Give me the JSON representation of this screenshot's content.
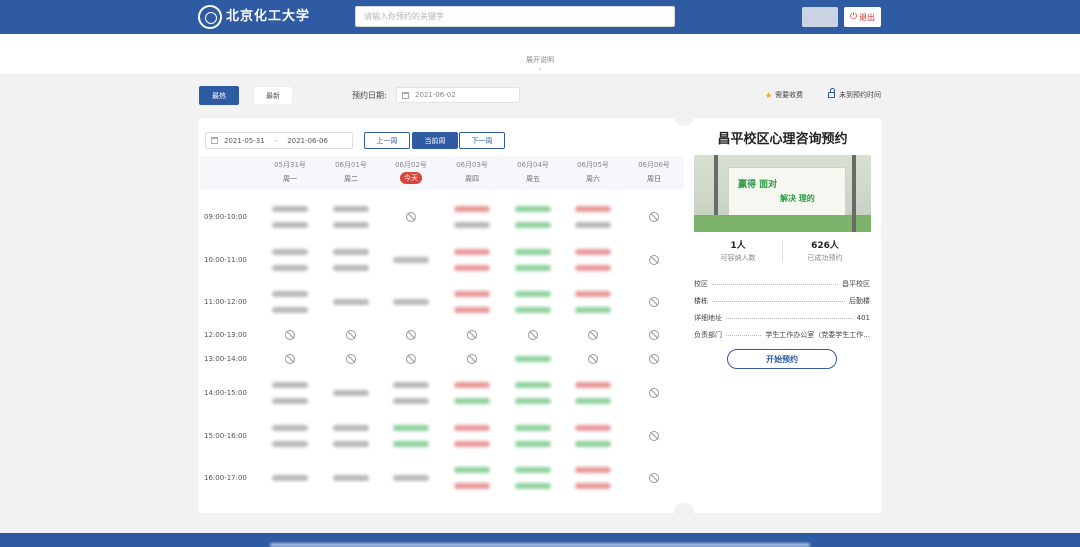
{
  "header": {
    "logo_text": "北京化工大学",
    "search_placeholder": "请输入你预约的关键字",
    "logout_label": "退出",
    "logout_icon": "power-icon"
  },
  "explain": {
    "label": "展开说明",
    "icon": "chevron-down-icon"
  },
  "filters": {
    "hot_label": "最热",
    "new_label": "最新",
    "date_label": "预约日期:",
    "date_value": "2021-06-02",
    "legend_favorite": "需要收费",
    "legend_locked": "未到预约时间"
  },
  "week": {
    "range_start": "2021-05-31",
    "range_sep": "-",
    "range_end": "2021-06-06",
    "prev_label": "上一周",
    "current_label": "当前周",
    "next_label": "下一周"
  },
  "days": [
    {
      "date": "05月31号",
      "weekday": "周一"
    },
    {
      "date": "06月01号",
      "weekday": "周二"
    },
    {
      "date": "06月02号",
      "weekday": "今天"
    },
    {
      "date": "06月03号",
      "weekday": "周四"
    },
    {
      "date": "06月04号",
      "weekday": "周五"
    },
    {
      "date": "06月05号",
      "weekday": "周六"
    },
    {
      "date": "06月06号",
      "weekday": "周日"
    }
  ],
  "slots": [
    "09:00-10:00",
    "10:00-11:00",
    "11:00-12:00",
    "12:00-13:00",
    "13:00-14:00",
    "14:00-15:00",
    "15:00-16:00",
    "16:00-17:00"
  ],
  "side": {
    "title": "昌平校区心理咨询预约",
    "image_text1": "赢得 面对",
    "image_text2": "解决 理的",
    "capacity_value": "1人",
    "capacity_label": "可容纳人数",
    "success_value": "626人",
    "success_label": "已成功预约",
    "info": [
      {
        "key": "校区",
        "value": "昌平校区"
      },
      {
        "key": "楼栋",
        "value": "后勤楼"
      },
      {
        "key": "详细地址",
        "value": "401"
      },
      {
        "key": "负责部门",
        "value": "学生工作办公室（党委学生工作..."
      }
    ],
    "start_label": "开始预约"
  },
  "colors": {
    "primary": "#2f5ba3",
    "today": "#d9453d",
    "logout": "#d32f2f"
  }
}
